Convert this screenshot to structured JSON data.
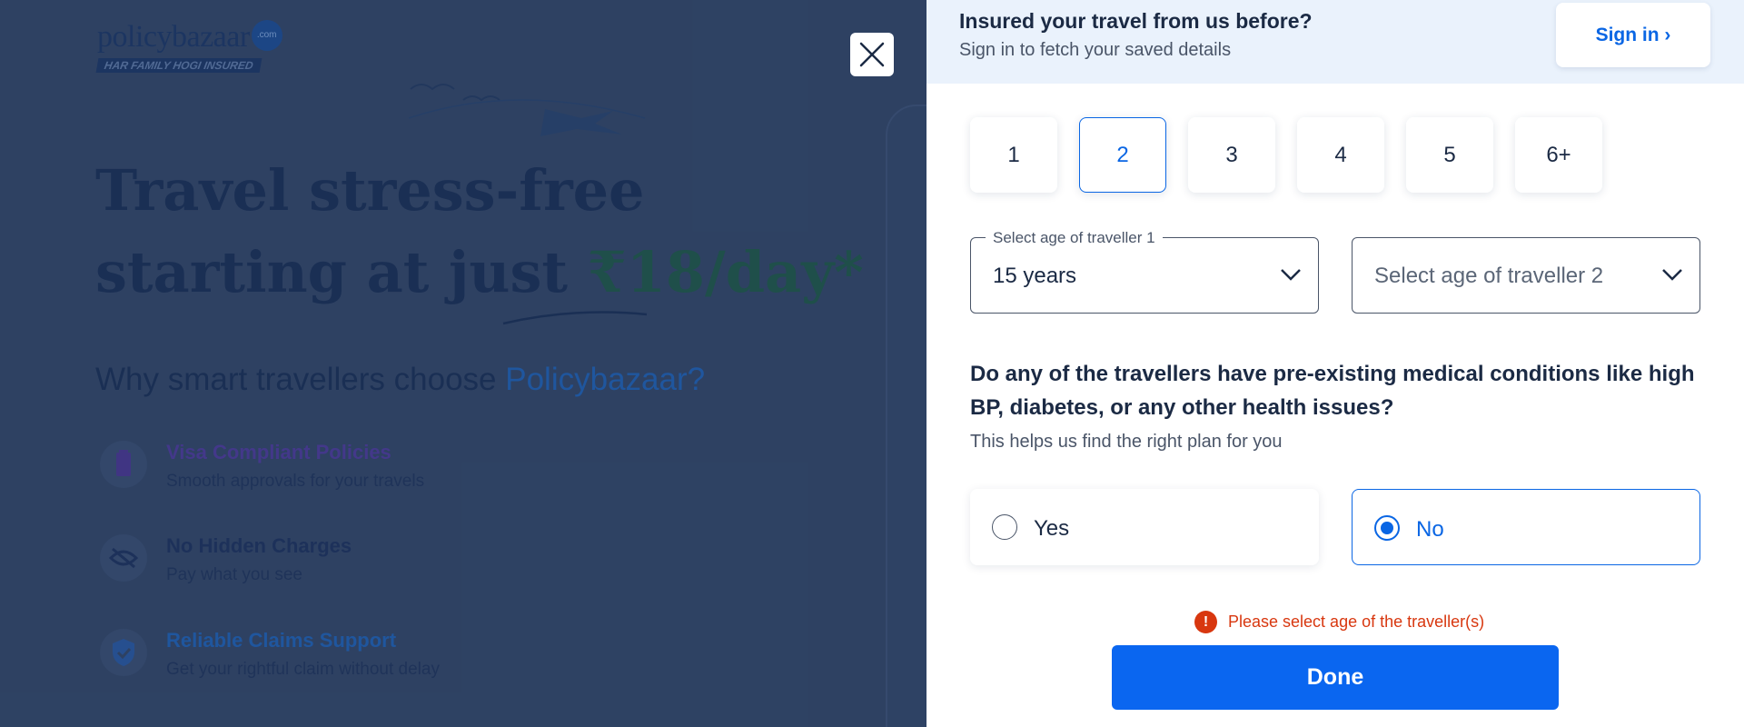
{
  "background": {
    "logo_text": "policybazaar",
    "logo_badge": ".com",
    "logo_tagline": "HAR FAMILY HOGI INSURED",
    "headline_line1": "Travel stress-free",
    "headline_line2_prefix": "starting at just ",
    "headline_price": "₹18/day*",
    "why_prefix": "Why smart travellers choose ",
    "why_brand": "Policybazaar?",
    "features": [
      {
        "title": "Visa Compliant Policies",
        "subtitle": "Smooth approvals for your travels",
        "icon": "passport-icon",
        "color": "#5a47a8"
      },
      {
        "title": "No Hidden Charges",
        "subtitle": "Pay what you see",
        "icon": "eye-off-icon",
        "color": "#1f3560"
      },
      {
        "title": "Reliable Claims Support",
        "subtitle": "Get your rightful claim without delay",
        "icon": "shield-check-icon",
        "color": "#2262b3"
      }
    ]
  },
  "close_button": {
    "icon": "close-icon"
  },
  "signin": {
    "title": "Insured your travel from us before?",
    "subtitle": "Sign in to fetch your saved details",
    "button_label": "Sign in ›"
  },
  "traveller_count": {
    "options": [
      "1",
      "2",
      "3",
      "4",
      "5",
      "6+"
    ],
    "selected": "2"
  },
  "age_selects": [
    {
      "legend": "Select age of traveller 1",
      "value": "15 years",
      "placeholder": ""
    },
    {
      "legend": "",
      "value": "",
      "placeholder": "Select age of traveller 2"
    }
  ],
  "medical": {
    "question": "Do any of the travellers have pre-existing medical conditions like high BP, diabetes, or any other health issues?",
    "helper": "This helps us find the right plan for you",
    "options": [
      "Yes",
      "No"
    ],
    "selected": "No"
  },
  "error": {
    "icon": "exclamation-icon",
    "text": "Please select age of the traveller(s)"
  },
  "done_button": {
    "label": "Done"
  },
  "colors": {
    "accent": "#0a66e4",
    "error": "#d8370f",
    "overlay": "#34496a"
  }
}
